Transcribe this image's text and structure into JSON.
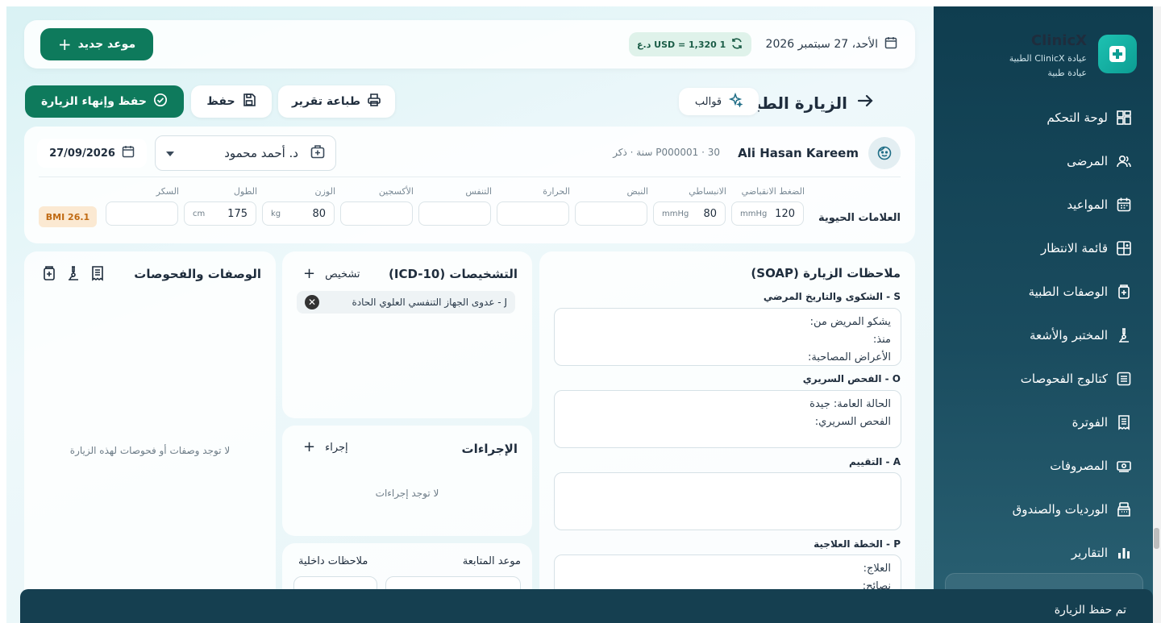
{
  "brand": {
    "name": "ClinicX",
    "subtitle_1": "عيادة ClinicX الطبية",
    "subtitle_2": "عيادة طبية"
  },
  "sidebar": {
    "items": [
      {
        "label": "لوحة التحكم",
        "icon": "dashboard-icon"
      },
      {
        "label": "المرضى",
        "icon": "users-icon"
      },
      {
        "label": "المواعيد",
        "icon": "calendar-icon"
      },
      {
        "label": "قائمة الانتظار",
        "icon": "queue-icon"
      },
      {
        "label": "الوصفات الطبية",
        "icon": "prescription-icon"
      },
      {
        "label": "المختبر والأشعة",
        "icon": "microscope-icon"
      },
      {
        "label": "كتالوج الفحوصات",
        "icon": "catalog-icon"
      },
      {
        "label": "الفوترة",
        "icon": "invoice-icon"
      },
      {
        "label": "المصروفات",
        "icon": "expenses-icon"
      },
      {
        "label": "الورديات والصندوق",
        "icon": "cash-register-icon"
      },
      {
        "label": "التقارير",
        "icon": "bar-chart-icon"
      }
    ]
  },
  "topbar": {
    "new_appointment": "موعد جديد",
    "rate": "1 USD = 1,320 د.ع",
    "date": "الأحد، 27 سبتمبر 2026"
  },
  "header": {
    "title": "الزيارة الطبية",
    "templates": "قوالب",
    "print_report": "طباعة تقرير",
    "save": "حفظ",
    "save_finish": "حفظ وإنهاء الزيارة"
  },
  "patient": {
    "name": "Ali Hasan Kareem",
    "meta": "P000001 · 30 سنة · ذكر",
    "doctor": "د. أحمد محمود",
    "visit_date": "27/09/2026"
  },
  "vitals": {
    "section_label": "العلامات الحيوية",
    "bmi": "BMI 26.1",
    "fields": [
      {
        "label": "الضغط الانقباضي",
        "value": "120",
        "unit": "mmHg"
      },
      {
        "label": "الانبساطي",
        "value": "80",
        "unit": "mmHg"
      },
      {
        "label": "النبض",
        "value": "",
        "unit": ""
      },
      {
        "label": "الحرارة",
        "value": "",
        "unit": ""
      },
      {
        "label": "التنفس",
        "value": "",
        "unit": ""
      },
      {
        "label": "الأكسجين",
        "value": "",
        "unit": ""
      },
      {
        "label": "الوزن",
        "value": "80",
        "unit": "kg"
      },
      {
        "label": "الطول",
        "value": "175",
        "unit": "cm"
      },
      {
        "label": "السكر",
        "value": "",
        "unit": ""
      }
    ]
  },
  "soap": {
    "title": "ملاحظات الزيارة (SOAP)",
    "s_label": "S - الشكوى والتاريخ المرضي",
    "s_lines": [
      "يشكو المريض من:",
      "منذ:",
      "الأعراض المصاحبة:"
    ],
    "o_label": "O - الفحص السريري",
    "o_lines": [
      "الحالة العامة: جيدة",
      "الفحص السريري:"
    ],
    "a_label": "A - التقييم",
    "p_label": "P - الخطة العلاجية",
    "p_lines": [
      "العلاج:",
      "نصائح:"
    ]
  },
  "diagnoses": {
    "title": "التشخيصات (ICD-10)",
    "add": "تشخيص",
    "items": [
      "J - عدوى الجهاز التنفسي العلوي الحادة"
    ]
  },
  "procedures": {
    "title": "الإجراءات",
    "add": "إجراء",
    "empty": "لا توجد إجراءات"
  },
  "followup": {
    "followup_label": "موعد المتابعة",
    "notes_label": "ملاحظات داخلية"
  },
  "prescriptions": {
    "title": "الوصفات والفحوصات",
    "empty": "لا توجد وصفات أو فحوصات لهذه الزيارة"
  },
  "toast": {
    "message": "تم حفظ الزيارة"
  },
  "colors": {
    "primary": "#0e7a5c",
    "sidebar": "#0f3d4f",
    "accent": "#1ec2b2"
  }
}
